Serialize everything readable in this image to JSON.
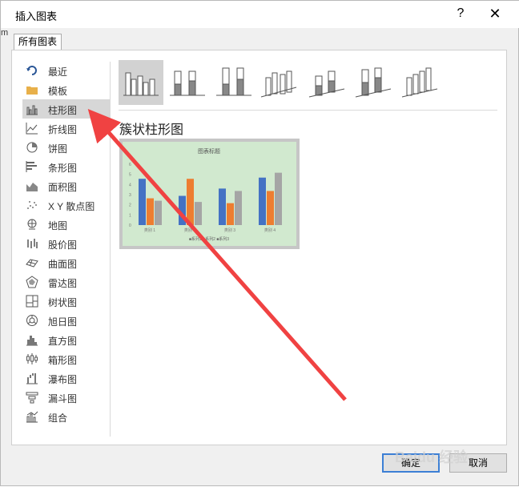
{
  "window": {
    "title": "插入图表",
    "help_label": "?",
    "close_label": "✕"
  },
  "side_stub": "m",
  "tab": {
    "label": "所有图表"
  },
  "sidebar": {
    "items": [
      {
        "label": "最近",
        "icon": "recent-icon"
      },
      {
        "label": "模板",
        "icon": "folder-icon"
      },
      {
        "label": "柱形图",
        "icon": "column-chart-icon",
        "selected": true
      },
      {
        "label": "折线图",
        "icon": "line-chart-icon"
      },
      {
        "label": "饼图",
        "icon": "pie-chart-icon"
      },
      {
        "label": "条形图",
        "icon": "bar-chart-icon"
      },
      {
        "label": "面积图",
        "icon": "area-chart-icon"
      },
      {
        "label": "X Y 散点图",
        "icon": "scatter-chart-icon"
      },
      {
        "label": "地图",
        "icon": "map-chart-icon"
      },
      {
        "label": "股价图",
        "icon": "stock-chart-icon"
      },
      {
        "label": "曲面图",
        "icon": "surface-chart-icon"
      },
      {
        "label": "雷达图",
        "icon": "radar-chart-icon"
      },
      {
        "label": "树状图",
        "icon": "treemap-chart-icon"
      },
      {
        "label": "旭日图",
        "icon": "sunburst-chart-icon"
      },
      {
        "label": "直方图",
        "icon": "histogram-chart-icon"
      },
      {
        "label": "箱形图",
        "icon": "box-whisker-chart-icon"
      },
      {
        "label": "瀑布图",
        "icon": "waterfall-chart-icon"
      },
      {
        "label": "漏斗图",
        "icon": "funnel-chart-icon"
      },
      {
        "label": "组合",
        "icon": "combo-chart-icon"
      }
    ]
  },
  "subtypes": {
    "selected_title": "簇状柱形图"
  },
  "preview": {
    "title": "图表标题",
    "y_ticks": [
      "6",
      "5",
      "4",
      "3",
      "2",
      "1",
      "0"
    ],
    "categories": [
      "类别 1",
      "类别 2",
      "类别 3",
      "类别 4"
    ],
    "legend": "■系列1 ■系列2 ■系列3",
    "colors": {
      "series1": "#4472c4",
      "series2": "#ed7d31",
      "series3": "#a5a5a5"
    }
  },
  "buttons": {
    "ok": "确定",
    "cancel": "取消"
  },
  "watermark": "Baidu 经验"
}
